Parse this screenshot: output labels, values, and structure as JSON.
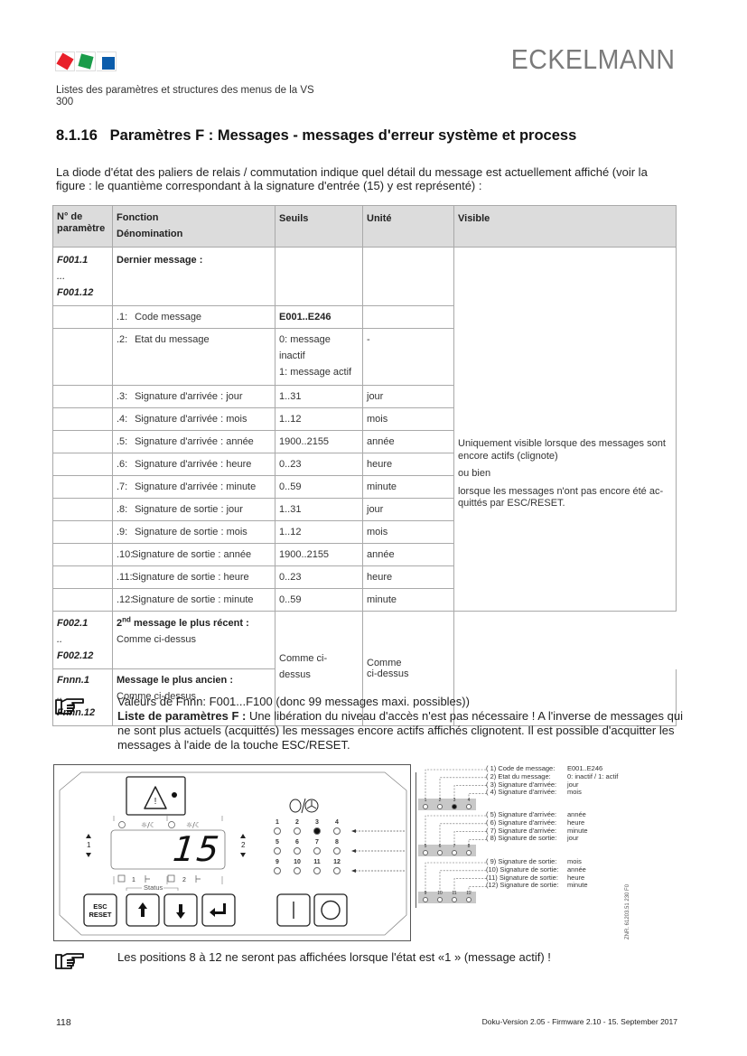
{
  "header": {
    "logo_colors": [
      "#e8202a",
      "#1a9c4a",
      "#0b5cab"
    ],
    "brand": "ECKELMANN",
    "subtitle_line1": "Listes des paramètres et structures des menus de la VS",
    "subtitle_line2": "300"
  },
  "section": {
    "number": "8.1.16",
    "title": "Paramètres F : Messages - messages d'erreur système et process"
  },
  "intro": "La diode d'état des paliers de relais / commutation indique quel détail du message est actuellement affiché (voir la figure : le quantième correspondant à la signature d'entrée (15) y est représenté) :",
  "table": {
    "headers": {
      "param_line1": "N° de",
      "param_line2": "paramètre",
      "function_line1": "Fonction",
      "function_line2": "Dénomination",
      "thresholds": "Seuils",
      "unit": "Unité",
      "visible": "Visible"
    },
    "group1": {
      "param_start": "F001.1",
      "param_dots": "...",
      "param_end": "F001.12",
      "title": "Dernier message :"
    },
    "rows": [
      {
        "idx": ".1:",
        "name": "Code message",
        "thresholds": "E001..E246",
        "unit": ""
      },
      {
        "idx": ".2:",
        "name": "Etat du message",
        "thresholds": "0: message inactif",
        "thresholds2": "1: message actif",
        "unit": "-"
      },
      {
        "idx": ".3:",
        "name": "Signature d'arrivée : jour",
        "thresholds": "1..31",
        "unit": "jour"
      },
      {
        "idx": ".4:",
        "name": "Signature d'arrivée : mois",
        "thresholds": "1..12",
        "unit": "mois"
      },
      {
        "idx": ".5:",
        "name": "Signature d'arrivée : année",
        "thresholds": "1900..2155",
        "unit": "année"
      },
      {
        "idx": ".6:",
        "name": "Signature d'arrivée : heure",
        "thresholds": "0..23",
        "unit": "heure"
      },
      {
        "idx": ".7:",
        "name": "Signature d'arrivée : minute",
        "thresholds": "0..59",
        "unit": "minute"
      },
      {
        "idx": ".8:",
        "name": "Signature de sortie : jour",
        "thresholds": "1..31",
        "unit": "jour"
      },
      {
        "idx": ".9:",
        "name": "Signature de sortie : mois",
        "thresholds": "1..12",
        "unit": "mois"
      },
      {
        "idx": ".10:",
        "name": "Signature de sortie : année",
        "thresholds": "1900..2155",
        "unit": "année"
      },
      {
        "idx": ".11:",
        "name": "Signature de sortie : heure",
        "thresholds": "0..23",
        "unit": "heure"
      },
      {
        "idx": ".12:",
        "name": "Signature de sortie : minute",
        "thresholds": "0..59",
        "unit": "minute"
      }
    ],
    "visible_note": {
      "p1": "Uniquement visible lorsque des messages sont encore actifs (clignote)",
      "p2": "ou bien",
      "p3": "lorsque les messages n'ont pas encore été ac-quittés par ESC/RESET."
    },
    "group2": {
      "param_start": "F002.1",
      "param_dots": "..",
      "param_end": "F002.12",
      "title_num": "2",
      "title_sup": "nd",
      "title_rest": " message le plus récent :",
      "desc": "Comme ci-dessus"
    },
    "group3": {
      "param_start": "Fnnn.1",
      "param_dots": "..",
      "param_end": "Fnnn.12",
      "title": "Message le plus ancien :",
      "desc": "Comme ci-dessus"
    },
    "shared_thresholds": "Comme ci-dessus",
    "shared_unit_line1": "Comme",
    "shared_unit_line2": "ci-dessus"
  },
  "note1": {
    "line1": "Valeurs de Fnnn: F001...F100 (donc 99 messages maxi. possibles))",
    "bold_label": "Liste de paramètres F :",
    "rest": " Une libération du niveau d'accès n'est pas nécessaire ! A l'inverse de messages qui ne sont plus actuels (acquittés) les messages encore actifs affichés clignotent. Il est possible d'acquitter les messages à l'aide de la touche ESC/RESET."
  },
  "figure": {
    "display_value": "15",
    "left_channel": "1",
    "right_channel": "2",
    "status_label": "Status",
    "esc_line1": "ESC",
    "esc_line2": "RESET",
    "led_labels": [
      "1",
      "2",
      "3",
      "4",
      "5",
      "6",
      "7",
      "8",
      "9",
      "10",
      "11",
      "12"
    ],
    "active_led": 3,
    "bottom_ch1": "1",
    "bottom_ch2": "2",
    "legend_groups": [
      {
        "leds": [
          "1",
          "2",
          "3",
          "4"
        ],
        "items": [
          {
            "label": "( 1) Code de message:",
            "value": "E001..E246"
          },
          {
            "label": "( 2) Etat du message:",
            "value": "0: inactif / 1: actif"
          },
          {
            "label": "( 3) Signature d'arrivée:",
            "value": "jour"
          },
          {
            "label": "( 4) Signature d'arrivée:",
            "value": "mois"
          }
        ]
      },
      {
        "leds": [
          "5",
          "6",
          "7",
          "8"
        ],
        "items": [
          {
            "label": "( 5) Signature d'arrivée:",
            "value": "année"
          },
          {
            "label": "( 6) Signature d'arrivée:",
            "value": "heure"
          },
          {
            "label": "( 7) Signature d'arrivée:",
            "value": "minute"
          },
          {
            "label": "( 8) Signature de sortie:",
            "value": "jour"
          }
        ]
      },
      {
        "leds": [
          "9",
          "10",
          "11",
          "12"
        ],
        "items": [
          {
            "label": "( 9)  Signature de sortie:",
            "value": "mois"
          },
          {
            "label": "(10) Signature de sortie:",
            "value": "année"
          },
          {
            "label": "(11) Signature de sortie:",
            "value": "heure"
          },
          {
            "label": "(12) Signature de sortie:",
            "value": "minute"
          }
        ]
      }
    ],
    "reference": "ZNR. 61203.51 230 F0"
  },
  "note2": "Les positions 8 à 12 ne seront pas affichées lorsque l'état est «1 » (message actif) !",
  "footer": {
    "page_number": "118",
    "version": "Doku-Version 2.05 - Firmware 2.10 - 15. September 2017"
  }
}
